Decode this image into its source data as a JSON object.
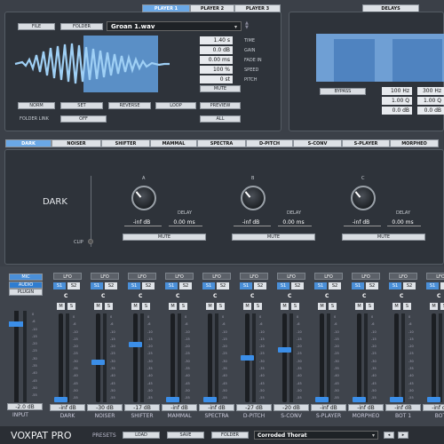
{
  "players": {
    "tabs": [
      "PLAYER 1",
      "PLAYER 2",
      "PLAYER 3"
    ],
    "file_btn": "FILE",
    "folder_btn": "FOLDER",
    "filename": "Groan 1.wav",
    "params": [
      {
        "value": "1.40 s",
        "label": "TIME"
      },
      {
        "value": "0.0 dB",
        "label": "GAIN"
      },
      {
        "value": "0.00 ms",
        "label": "FADE IN"
      },
      {
        "value": "100 %",
        "label": "SPEED"
      },
      {
        "value": "0 st",
        "label": "PITCH"
      }
    ],
    "mute": "MUTE",
    "buttons": [
      "NORM",
      "SET",
      "REVERSE",
      "LOOP",
      "PREVIEW"
    ],
    "folder_link_label": "FOLDER LINK",
    "folder_link_value": "OFF",
    "all": "ALL"
  },
  "delays": {
    "tab": "DELAYS",
    "bypass": "BYPASS",
    "freqs": [
      "100 Hz",
      "300 Hz"
    ],
    "qs": [
      "1.00 Q",
      "1.00 Q"
    ],
    "gains": [
      "0.0 dB",
      "0.0 dB"
    ]
  },
  "fx": {
    "tabs": [
      "DARK",
      "NOISER",
      "SHIFTER",
      "MAMMAL",
      "SPECTRA",
      "D-PITCH",
      "S-CONV",
      "S-PLAYER",
      "MORPHEO"
    ],
    "title": "DARK",
    "clip": "CLIP",
    "channels": [
      {
        "letter": "A",
        "gain": "-inf dB",
        "delay_label": "DELAY",
        "delay": "0.00 ms",
        "mute": "MUTE"
      },
      {
        "letter": "B",
        "gain": "-inf dB",
        "delay_label": "DELAY",
        "delay": "0.00 ms",
        "mute": "MUTE"
      },
      {
        "letter": "C",
        "gain": "-inf dB",
        "delay_label": "DELAY",
        "delay": "0.00 ms",
        "mute": "MUTE"
      }
    ]
  },
  "input": {
    "modes": [
      "MIC",
      "AUDIO",
      "PLUGIN"
    ],
    "value": "-2.0 dB",
    "name": "INPUT"
  },
  "mixer": {
    "scale": [
      "0",
      "-6",
      "-10",
      "-15",
      "-20",
      "-25",
      "-30",
      "-35",
      "-40",
      "-45",
      "-50",
      "-55"
    ],
    "strips": [
      {
        "name": "DARK",
        "value": "-inf dB",
        "level": 0.0
      },
      {
        "name": "NOISER",
        "value": "-30 dB",
        "level": 0.45
      },
      {
        "name": "SHIFTER",
        "value": "-17 dB",
        "level": 0.66
      },
      {
        "name": "MAMMAL",
        "value": "-inf dB",
        "level": 0.0
      },
      {
        "name": "SPECTRA",
        "value": "-inf dB",
        "level": 0.0
      },
      {
        "name": "D-PITCH",
        "value": "-27 dB",
        "level": 0.5
      },
      {
        "name": "S-CONV",
        "value": "-20 dB",
        "level": 0.6
      },
      {
        "name": "S-PLAYER",
        "value": "-inf dB",
        "level": 0.0
      },
      {
        "name": "MORPHEO",
        "value": "-inf dB",
        "level": 0.0
      },
      {
        "name": "BOT 1",
        "value": "-inf dB",
        "level": 0.0
      },
      {
        "name": "BOT",
        "value": "-inf dB",
        "level": 0.0
      }
    ],
    "lfo": "LFO",
    "s1": "S1",
    "s2": "S2",
    "c": "C",
    "m": "M",
    "s": "S"
  },
  "footer": {
    "brand": "VOXPAT PRO",
    "presets": "PRESETS",
    "load": "LOAD",
    "save": "SAVE",
    "folder": "FOLDER",
    "preset_name": "Corroded Thorat"
  }
}
